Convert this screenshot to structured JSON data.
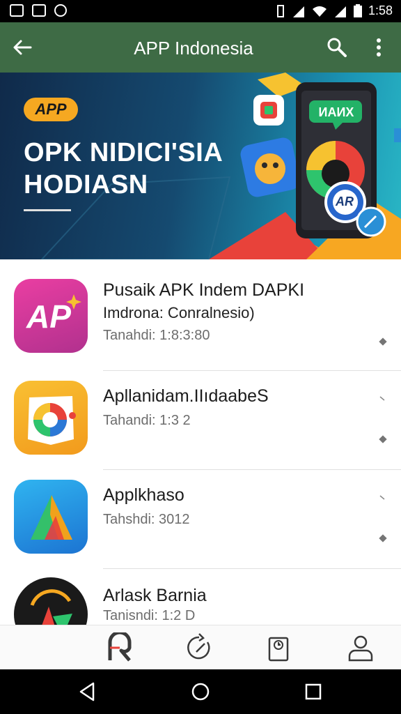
{
  "status_bar": {
    "time": "1:58"
  },
  "app_bar": {
    "title": "APP Indonesia",
    "back_icon": "arrow-left-icon",
    "search_icon": "search-icon",
    "more_icon": "more-vert-icon"
  },
  "banner": {
    "badge": "APP",
    "headline_line1": "OPK NIDICI'SIA",
    "headline_line2": "HODIASN",
    "phone_label": "ИAИX",
    "phone_badge": "AR"
  },
  "apps": [
    {
      "name": "Pusaik APK Indem DAPKI",
      "subtitle": "Imdrona: Conralnesio)",
      "date": "Tanahdi: 1:8:3:80",
      "icon": "ap-logo-icon",
      "icon_text": "AP",
      "icon_colors": [
        "#e0359a",
        "#b52e8a"
      ]
    },
    {
      "name": "Apllanidam.IIıdaabeS",
      "subtitle": "",
      "date": "Tahandi: 1:3 2",
      "icon": "chrome-ring-icon",
      "icon_colors": [
        "#f7b42c",
        "#f39a1e"
      ]
    },
    {
      "name": "Applkhaso",
      "subtitle": "",
      "date": "Tahshdi: 3012",
      "icon": "triangle-a-icon",
      "icon_colors": [
        "#2aa3e8",
        "#1d7bd6"
      ]
    },
    {
      "name": "Arlask Barnia",
      "subtitle": "",
      "date": "Tanisndi: 1:2 D",
      "icon": "av-logo-icon",
      "icon_colors": [
        "#1a1a1a"
      ]
    }
  ],
  "bottom_nav": [
    {
      "name": "home",
      "icon": "home-r-icon"
    },
    {
      "name": "updates",
      "icon": "refresh-icon"
    },
    {
      "name": "downloads",
      "icon": "clipboard-icon"
    },
    {
      "name": "profile",
      "icon": "person-icon"
    }
  ],
  "system_nav": [
    "back-triangle-icon",
    "home-circle-icon",
    "recents-square-icon"
  ],
  "colors": {
    "app_bar": "#3e6b45",
    "accent_orange": "#f6a821",
    "divider": "#e0e0e0"
  }
}
